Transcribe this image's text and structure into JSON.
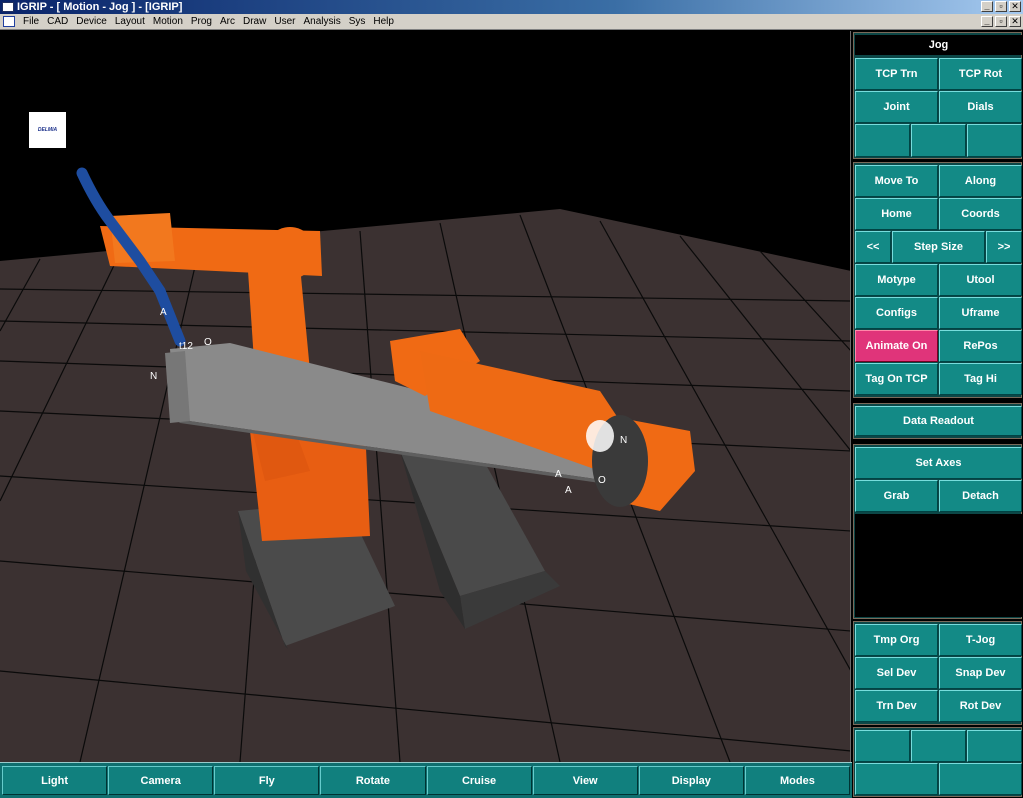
{
  "window": {
    "title": "IGRIP - [ Motion - Jog ] - [IGRIP]"
  },
  "menu": [
    "File",
    "CAD",
    "Device",
    "Layout",
    "Motion",
    "Prog",
    "Arc",
    "Draw",
    "User",
    "Analysis",
    "Sys",
    "Help"
  ],
  "logo": {
    "text": "DELMIA"
  },
  "viewport_labels": {
    "tool_a": "A",
    "tool_t12": "t12",
    "tool_o": "O",
    "tool_n": "N",
    "tag_a1": "A",
    "tag_a2": "A",
    "tag_o": "O",
    "tag_n": "N"
  },
  "bottom_buttons": [
    "Light",
    "Camera",
    "Fly",
    "Rotate",
    "Cruise",
    "View",
    "Display",
    "Modes"
  ],
  "panel": {
    "title": "Jog",
    "tcp_trn": "TCP Trn",
    "tcp_rot": "TCP Rot",
    "joint": "Joint",
    "dials": "Dials",
    "move_to": "Move To",
    "along": "Along",
    "home": "Home",
    "coords": "Coords",
    "step_prev": "<<",
    "step_size": "Step Size",
    "step_next": ">>",
    "motype": "Motype",
    "utool": "Utool",
    "configs": "Configs",
    "uframe": "Uframe",
    "animate_on": "Animate On",
    "repos": "RePos",
    "tag_on_tcp": "Tag On TCP",
    "tag_hi": "Tag Hi",
    "data_readout": "Data Readout",
    "set_axes": "Set Axes",
    "grab": "Grab",
    "detach": "Detach",
    "tmp_org": "Tmp Org",
    "t_jog": "T-Jog",
    "sel_dev": "Sel Dev",
    "snap_dev": "Snap Dev",
    "trn_dev": "Trn Dev",
    "rot_dev": "Rot Dev"
  },
  "colors": {
    "teal": "#138a86",
    "active": "#e0347a",
    "robot": "#f06010",
    "floor": "#3a3030"
  }
}
